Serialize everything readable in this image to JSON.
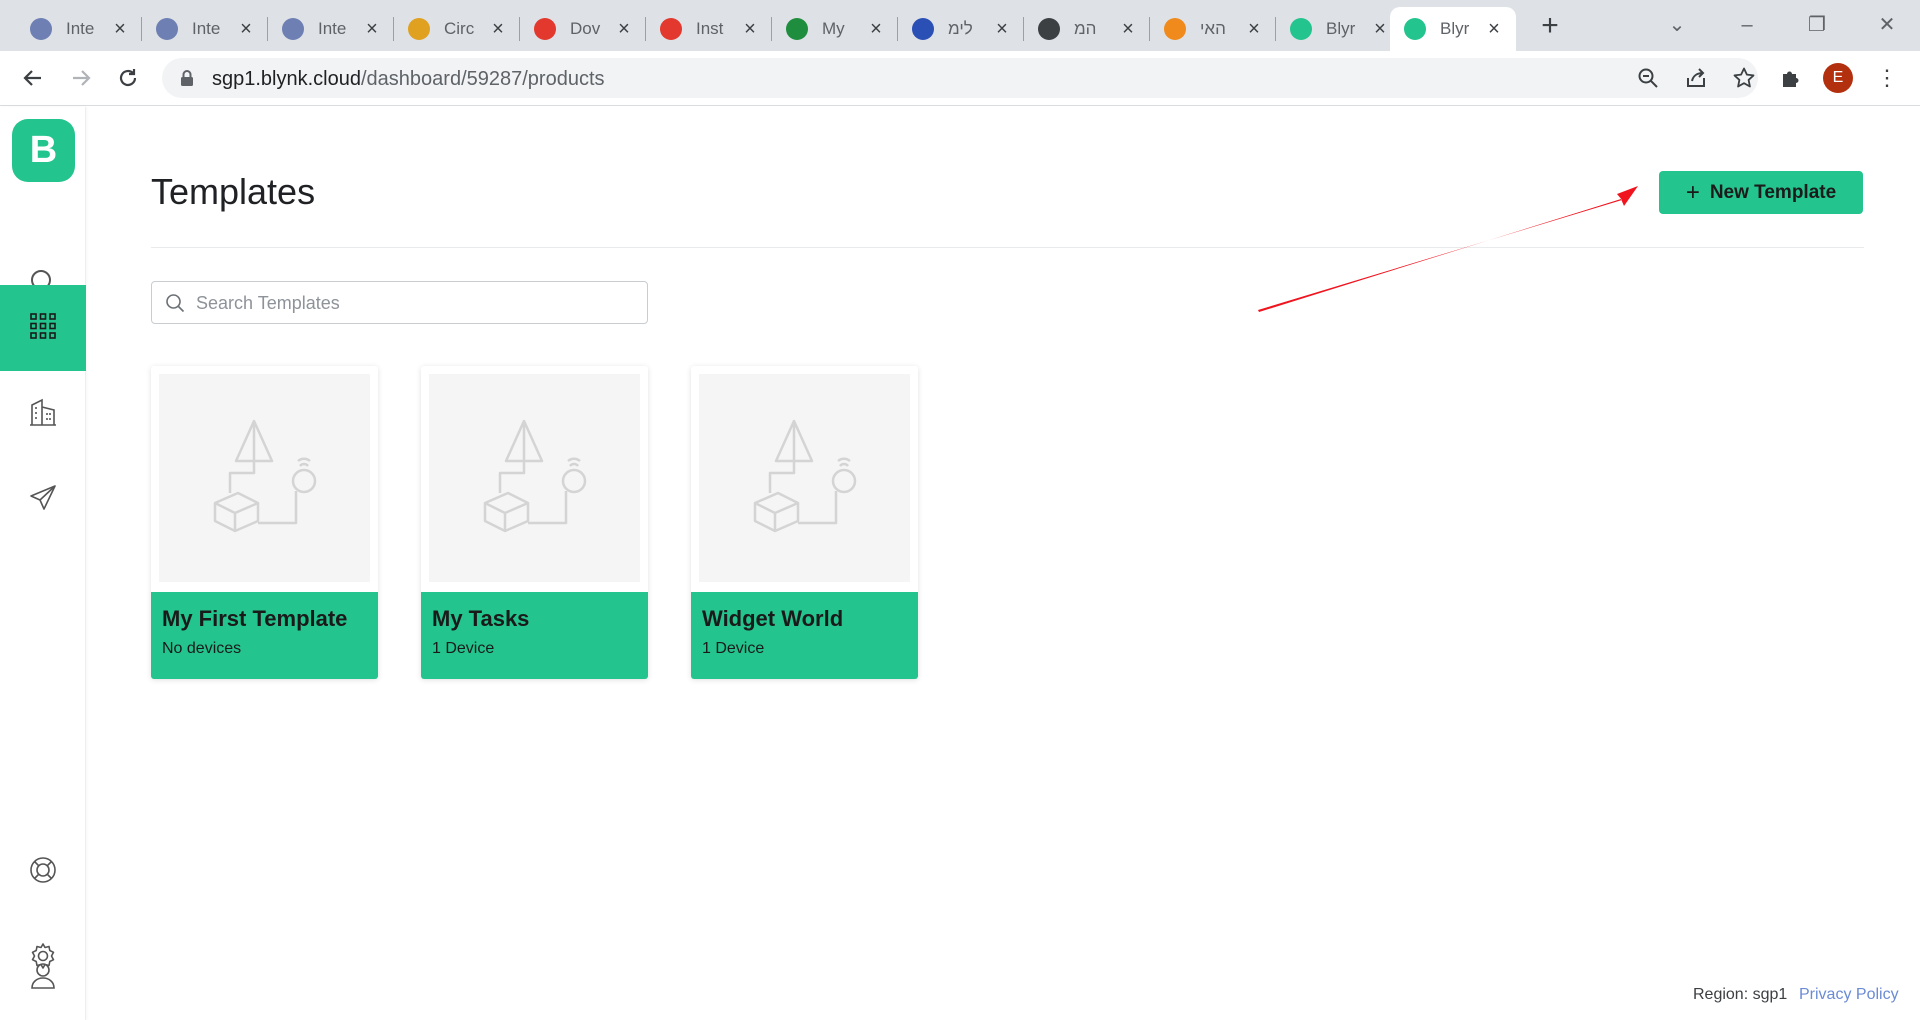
{
  "browser": {
    "tabs": [
      {
        "title": "Inte",
        "favicon": "info-icon",
        "color": "#6d7fb3"
      },
      {
        "title": "Inte",
        "favicon": "info-icon",
        "color": "#6d7fb3"
      },
      {
        "title": "Inte",
        "favicon": "info-icon",
        "color": "#6d7fb3"
      },
      {
        "title": "Circ",
        "favicon": "mascot-icon",
        "color": "#e0a020"
      },
      {
        "title": "Dov",
        "favicon": "pdf-icon",
        "color": "#e2382d"
      },
      {
        "title": "Inst",
        "favicon": "pdf-icon",
        "color": "#e2382d"
      },
      {
        "title": "My",
        "favicon": "sheets-icon",
        "color": "#1e8e3e"
      },
      {
        "title": "לימ",
        "favicon": "ru-icon",
        "color": "#2a4fb5"
      },
      {
        "title": "המ",
        "favicon": "globe-icon",
        "color": "#3c4043"
      },
      {
        "title": "האי",
        "favicon": "moodle-icon",
        "color": "#f08a1c"
      },
      {
        "title": "Blyr",
        "favicon": "blynk-icon",
        "color": "#23c48e"
      },
      {
        "title": "Blyr",
        "favicon": "blynk-icon",
        "color": "#23c48e",
        "active": true
      }
    ],
    "address": {
      "host": "sgp1.blynk.cloud",
      "path": "/dashboard/59287/products"
    },
    "profile_initial": "E"
  },
  "app": {
    "logo_letter": "B",
    "accent_color": "#23c48e",
    "nav": [
      "search-icon",
      "templates-grid-icon",
      "organizations-building-icon",
      "send-icon"
    ],
    "nav_bottom": [
      "help-lifebuoy-icon",
      "settings-gear-icon",
      "user-profile-icon"
    ]
  },
  "page": {
    "title": "Templates",
    "new_button_label": "New Template",
    "search_placeholder": "Search Templates"
  },
  "templates": [
    {
      "name": "My First Template",
      "devices": "No devices"
    },
    {
      "name": "My Tasks",
      "devices": "1 Device"
    },
    {
      "name": "Widget World",
      "devices": "1 Device"
    }
  ],
  "footer": {
    "region": "Region: sgp1",
    "privacy": "Privacy Policy"
  }
}
